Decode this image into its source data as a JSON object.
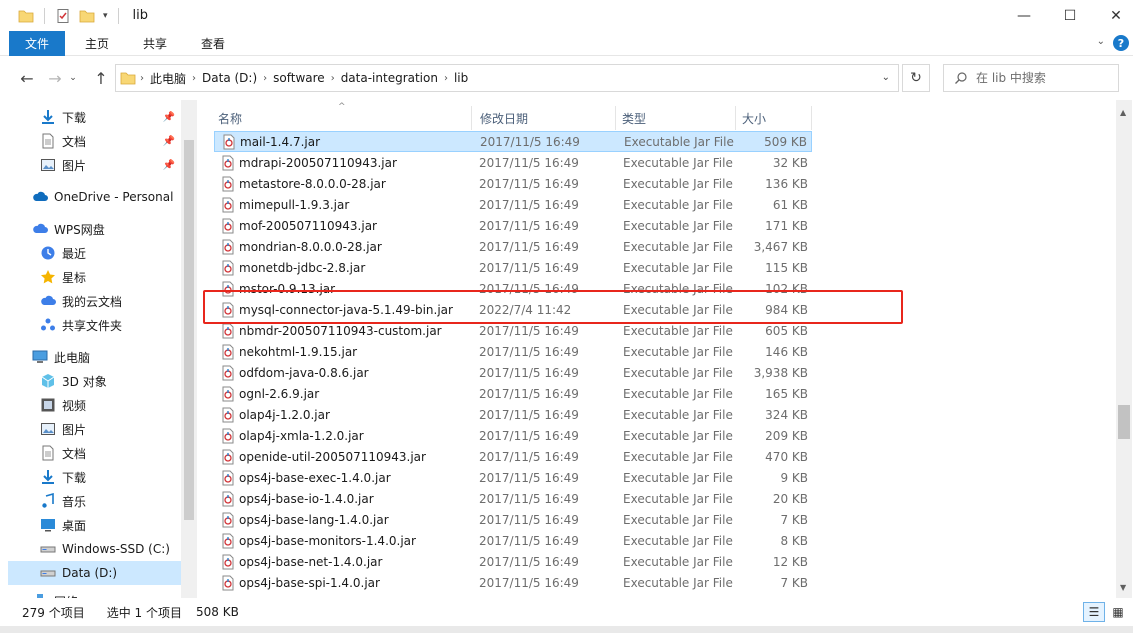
{
  "window": {
    "title": "lib"
  },
  "ribbon": {
    "file": "文件",
    "tabs": [
      "主页",
      "共享",
      "查看"
    ]
  },
  "address": {
    "crumbs": [
      "此电脑",
      "Data (D:)",
      "software",
      "data-integration",
      "lib"
    ]
  },
  "search": {
    "placeholder": "在 lib 中搜索"
  },
  "sidebar": {
    "items": [
      {
        "label": "下载",
        "icon": "download-arrow-icon",
        "pinned": true
      },
      {
        "label": "文档",
        "icon": "document-icon",
        "pinned": true
      },
      {
        "label": "图片",
        "icon": "picture-icon",
        "pinned": true
      },
      {
        "label": "OneDrive - Personal",
        "icon": "cloud-icon"
      },
      {
        "label": "WPS网盘",
        "icon": "wps-cloud-icon"
      },
      {
        "label": "最近",
        "icon": "clock-icon"
      },
      {
        "label": "星标",
        "icon": "star-icon"
      },
      {
        "label": "我的云文档",
        "icon": "cloud-doc-icon"
      },
      {
        "label": "共享文件夹",
        "icon": "shared-folder-icon"
      },
      {
        "label": "此电脑",
        "icon": "computer-icon"
      },
      {
        "label": "3D 对象",
        "icon": "cube-icon"
      },
      {
        "label": "视频",
        "icon": "video-icon"
      },
      {
        "label": "图片",
        "icon": "picture-icon"
      },
      {
        "label": "文档",
        "icon": "document-icon"
      },
      {
        "label": "下载",
        "icon": "download-arrow-icon"
      },
      {
        "label": "音乐",
        "icon": "music-note-icon"
      },
      {
        "label": "桌面",
        "icon": "desktop-icon"
      },
      {
        "label": "Windows-SSD (C:)",
        "icon": "drive-icon"
      },
      {
        "label": "Data (D:)",
        "icon": "drive-icon"
      },
      {
        "label": "网络",
        "icon": "network-icon"
      }
    ]
  },
  "columns": {
    "name": "名称",
    "date": "修改日期",
    "type": "类型",
    "size": "大小"
  },
  "files": [
    {
      "name": "mail-1.4.7.jar",
      "date": "2017/11/5 16:49",
      "type": "Executable Jar File",
      "size": "509 KB"
    },
    {
      "name": "mdrapi-200507110943.jar",
      "date": "2017/11/5 16:49",
      "type": "Executable Jar File",
      "size": "32 KB"
    },
    {
      "name": "metastore-8.0.0.0-28.jar",
      "date": "2017/11/5 16:49",
      "type": "Executable Jar File",
      "size": "136 KB"
    },
    {
      "name": "mimepull-1.9.3.jar",
      "date": "2017/11/5 16:49",
      "type": "Executable Jar File",
      "size": "61 KB"
    },
    {
      "name": "mof-200507110943.jar",
      "date": "2017/11/5 16:49",
      "type": "Executable Jar File",
      "size": "171 KB"
    },
    {
      "name": "mondrian-8.0.0.0-28.jar",
      "date": "2017/11/5 16:49",
      "type": "Executable Jar File",
      "size": "3,467 KB"
    },
    {
      "name": "monetdb-jdbc-2.8.jar",
      "date": "2017/11/5 16:49",
      "type": "Executable Jar File",
      "size": "115 KB"
    },
    {
      "name": "mstor-0.9.13.jar",
      "date": "2017/11/5 16:49",
      "type": "Executable Jar File",
      "size": "102 KB"
    },
    {
      "name": "mysql-connector-java-5.1.49-bin.jar",
      "date": "2022/7/4 11:42",
      "type": "Executable Jar File",
      "size": "984 KB"
    },
    {
      "name": "nbmdr-200507110943-custom.jar",
      "date": "2017/11/5 16:49",
      "type": "Executable Jar File",
      "size": "605 KB"
    },
    {
      "name": "nekohtml-1.9.15.jar",
      "date": "2017/11/5 16:49",
      "type": "Executable Jar File",
      "size": "146 KB"
    },
    {
      "name": "odfdom-java-0.8.6.jar",
      "date": "2017/11/5 16:49",
      "type": "Executable Jar File",
      "size": "3,938 KB"
    },
    {
      "name": "ognl-2.6.9.jar",
      "date": "2017/11/5 16:49",
      "type": "Executable Jar File",
      "size": "165 KB"
    },
    {
      "name": "olap4j-1.2.0.jar",
      "date": "2017/11/5 16:49",
      "type": "Executable Jar File",
      "size": "324 KB"
    },
    {
      "name": "olap4j-xmla-1.2.0.jar",
      "date": "2017/11/5 16:49",
      "type": "Executable Jar File",
      "size": "209 KB"
    },
    {
      "name": "openide-util-200507110943.jar",
      "date": "2017/11/5 16:49",
      "type": "Executable Jar File",
      "size": "470 KB"
    },
    {
      "name": "ops4j-base-exec-1.4.0.jar",
      "date": "2017/11/5 16:49",
      "type": "Executable Jar File",
      "size": "9 KB"
    },
    {
      "name": "ops4j-base-io-1.4.0.jar",
      "date": "2017/11/5 16:49",
      "type": "Executable Jar File",
      "size": "20 KB"
    },
    {
      "name": "ops4j-base-lang-1.4.0.jar",
      "date": "2017/11/5 16:49",
      "type": "Executable Jar File",
      "size": "7 KB"
    },
    {
      "name": "ops4j-base-monitors-1.4.0.jar",
      "date": "2017/11/5 16:49",
      "type": "Executable Jar File",
      "size": "8 KB"
    },
    {
      "name": "ops4j-base-net-1.4.0.jar",
      "date": "2017/11/5 16:49",
      "type": "Executable Jar File",
      "size": "12 KB"
    },
    {
      "name": "ops4j-base-spi-1.4.0.jar",
      "date": "2017/11/5 16:49",
      "type": "Executable Jar File",
      "size": "7 KB"
    }
  ],
  "status": {
    "count": "279 个项目",
    "selected": "选中 1 个项目",
    "size": "508 KB"
  },
  "colors": {
    "accent": "#1979ca",
    "selection": "#cce8ff",
    "highlight": "#e8261c"
  }
}
